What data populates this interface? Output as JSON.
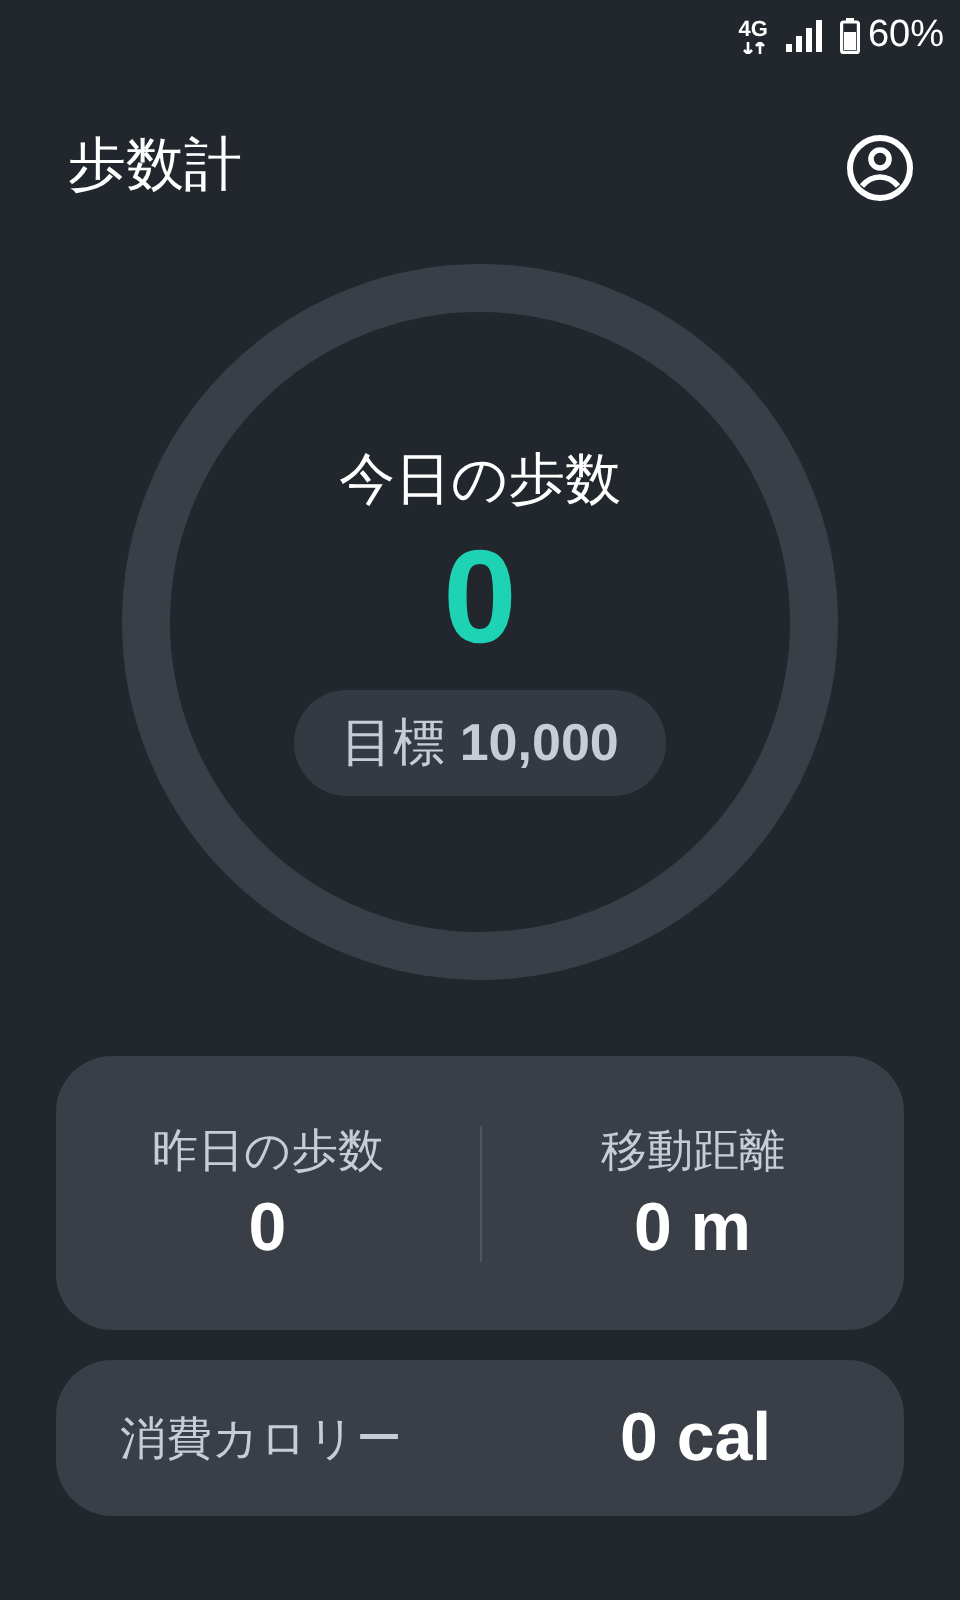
{
  "status_bar": {
    "network": "4G",
    "battery": "60%"
  },
  "header": {
    "title": "歩数計"
  },
  "today": {
    "label": "今日の歩数",
    "steps": "0",
    "goal": "目標 **10,000**"
  },
  "stats": [
    {
      "label": "昨日の歩数",
      "value": "0"
    },
    {
      "label": "移動距離",
      "value": "0 m"
    }
  ],
  "calories": {
    "label": "消費カロリー",
    "value": "0 cal"
  }
}
